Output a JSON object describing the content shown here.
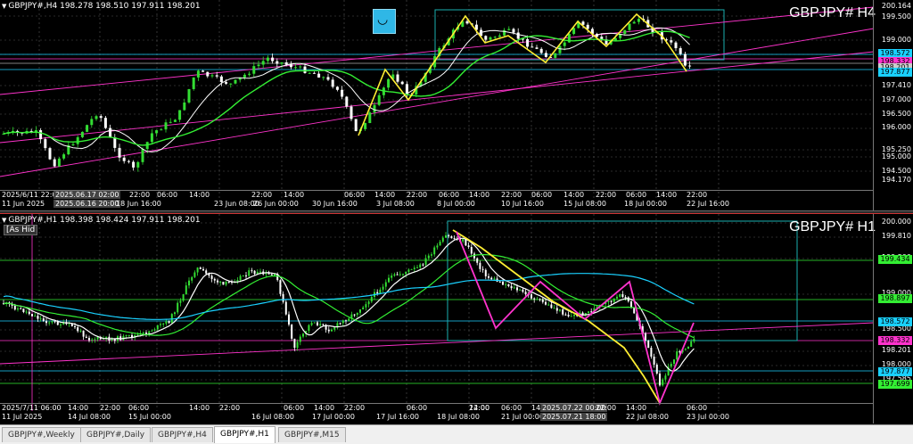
{
  "h4": {
    "header": "GBPJPY#,H4 198.278 198.510 197.911 198.201",
    "symbol": "GBPJPY# H4",
    "price_ticks": [
      "200.164",
      "199.500",
      "199.000",
      "198.572",
      "198.332",
      "198.201",
      "197.877",
      "197.410",
      "197.000",
      "196.500",
      "196.000",
      "195.250",
      "195.000",
      "194.500",
      "194.170"
    ],
    "labels": [
      {
        "text": "198.572",
        "bg": "#1ad1ff",
        "fg": "#000"
      },
      {
        "text": "198.332",
        "bg": "#ff33cc",
        "fg": "#000"
      },
      {
        "text": "198.201",
        "bg": "#cccccc",
        "fg": "#000"
      },
      {
        "text": "197.877",
        "bg": "#1ad1ff",
        "fg": "#000"
      }
    ],
    "time_labels": [
      "2025/6/11 22:00",
      "2025.06.17 02:00",
      "11 Jun 2025",
      "2025.06.16 20:00",
      "18 Jun 16:00",
      "22:00",
      "06:00",
      "14:00",
      "23 Jun 08:00",
      "22:00",
      "26 Jun 00:00",
      "14:00",
      "30 Jun 16:00",
      "06:00",
      "14:00",
      "3 Jul 08:00",
      "22:00",
      "8 Jul 00:00",
      "06:00",
      "14:00",
      "22:00",
      "10 Jul 16:00",
      "06:00",
      "15 Jul 08:00",
      "14:00",
      "22:00",
      "18 Jul 00:00",
      "06:00",
      "14:00",
      "22 Jul 16:00",
      "22:00"
    ],
    "icon": "smile-icon"
  },
  "h1": {
    "header": "GBPJPY#,H1 198.398 198.424 197.911 198.201",
    "symbol": "GBPJPY# H1",
    "as_hide": "[As Hid",
    "price_ticks": [
      "200.000",
      "199.810",
      "199.500",
      "199.000",
      "198.500",
      "198.201",
      "198.000",
      "197.585"
    ],
    "labels": [
      {
        "text": "199.434",
        "bg": "#33ee33",
        "fg": "#000"
      },
      {
        "text": "198.897",
        "bg": "#33ee33",
        "fg": "#000"
      },
      {
        "text": "198.572",
        "bg": "#1ad1ff",
        "fg": "#000"
      },
      {
        "text": "198.332",
        "bg": "#ff33cc",
        "fg": "#000"
      },
      {
        "text": "197.877",
        "bg": "#1ad1ff",
        "fg": "#000"
      },
      {
        "text": "197.699",
        "bg": "#33ee33",
        "fg": "#000"
      }
    ],
    "time_labels": [
      "2025/7/11 06:00",
      "11 Jul 2025",
      "14:00",
      "14 Jul 08:00",
      "22:00",
      "06:00",
      "15 Jul 00:00",
      "14:00",
      "22:00",
      "16 Jul 08:00",
      "06:00",
      "17 Jul 00:00",
      "14:00",
      "22:00",
      "17 Jul 16:00",
      "06:00",
      "18 Jul 08:00",
      "14:00",
      "22:00",
      "21 Jul 00:00",
      "06:00",
      "14:",
      "2025.07.22 00:00",
      "2025.07.21 18:00",
      "22:00",
      "14:00",
      "22 Jul 08:00",
      "06:00",
      "23 Jul 00:00"
    ]
  },
  "tabs": [
    "GBPJPY#,Weekly",
    "GBPJPY#,Daily",
    "GBPJPY#,H4",
    "GBPJPY#,H1",
    "GBPJPY#,M15"
  ],
  "active_tab": "GBPJPY#,H1",
  "colors": {
    "bull": "#33dd33",
    "bear": "#ffffff",
    "ma_fast": "#33ee33",
    "ma_slow": "#1ad1ff",
    "channel": "#ff33cc",
    "zigzag_yellow": "#ffee33",
    "zigzag_magenta": "#ff33cc",
    "rect": "#1ab0b0"
  }
}
